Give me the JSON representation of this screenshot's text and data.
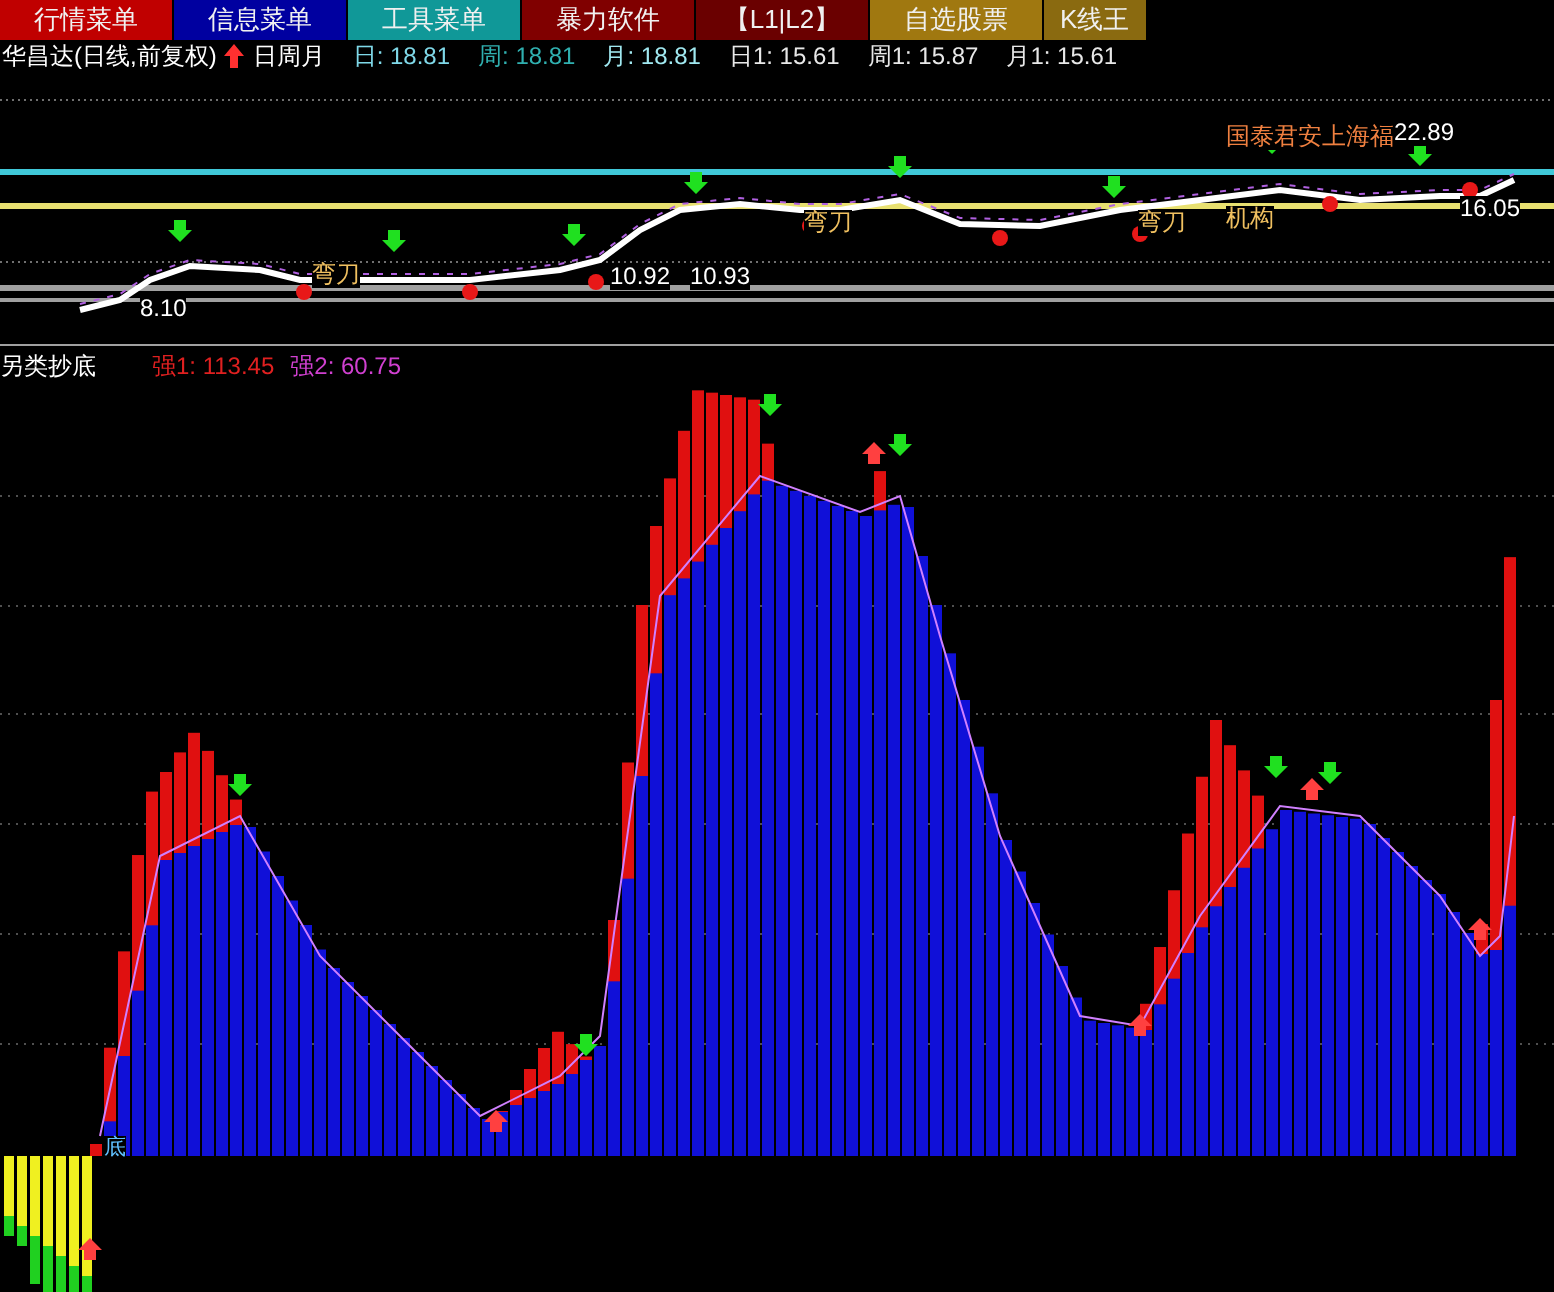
{
  "menu_tabs": [
    {
      "label": "行情菜单",
      "color": "#c00000"
    },
    {
      "label": "信息菜单",
      "color": "#0000a0"
    },
    {
      "label": "工具菜单",
      "color": "#109898"
    },
    {
      "label": "暴力软件",
      "color": "#800000"
    },
    {
      "label": "【L1|L2】",
      "color": "#6a0000"
    },
    {
      "label": "自选股票",
      "color": "#a07810"
    },
    {
      "label": "K线王",
      "color": "#8a6a10"
    }
  ],
  "info_line": {
    "title": "华昌达(日线,前复权)",
    "period": "日周月",
    "values": [
      {
        "text": "日: 18.81",
        "color": "#7fd8e8"
      },
      {
        "text": "周: 18.81",
        "color": "#30b0b0"
      },
      {
        "text": "月: 18.81",
        "color": "#a0e8f0"
      },
      {
        "text": "日1: 15.61",
        "color": "#e8e8e8"
      },
      {
        "text": "周1: 15.87",
        "color": "#e8e8e8"
      },
      {
        "text": "月1: 15.61",
        "color": "#e8e8e8"
      }
    ]
  },
  "price_chart": {
    "labels": [
      {
        "text": "8.10",
        "kind": "price"
      },
      {
        "text": "弯刀",
        "kind": "signal"
      },
      {
        "text": "10.92",
        "kind": "price"
      },
      {
        "text": "10.93",
        "kind": "price"
      },
      {
        "text": "弯刀",
        "kind": "signal"
      },
      {
        "text": "弯刀",
        "kind": "signal"
      },
      {
        "text": "机构",
        "kind": "signal"
      },
      {
        "text": "国泰君安上海福",
        "kind": "broker"
      },
      {
        "text": "22.89",
        "kind": "price"
      },
      {
        "text": "16.05",
        "kind": "price"
      }
    ]
  },
  "indicator": {
    "title": "另类抄底",
    "readings": [
      {
        "text": "强1: 113.45",
        "color": "#e02020"
      },
      {
        "text": "强2: 60.75",
        "color": "#d040d0"
      }
    ],
    "marker": "底"
  }
}
